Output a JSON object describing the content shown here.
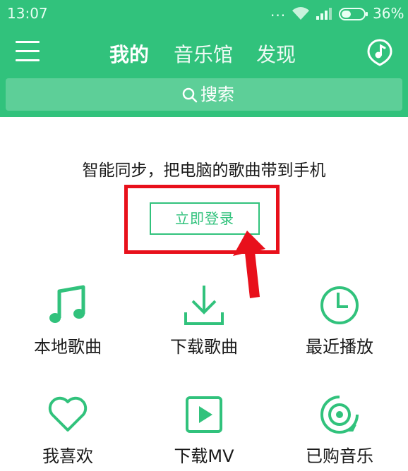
{
  "status_bar": {
    "time": "13:07",
    "dots": "...",
    "battery_pct": "36%"
  },
  "header": {
    "tabs": [
      {
        "label": "我的",
        "active": true
      },
      {
        "label": "音乐馆",
        "active": false
      },
      {
        "label": "发现",
        "active": false
      }
    ],
    "search_label": "搜索",
    "accent_color": "#31c27c"
  },
  "main": {
    "sync_text": "智能同步，把电脑的歌曲带到手机",
    "login_label": "立即登录"
  },
  "annotation": {
    "color": "#e8101b"
  },
  "grid": [
    {
      "label": "本地歌曲",
      "icon": "music-note-icon"
    },
    {
      "label": "下载歌曲",
      "icon": "download-icon"
    },
    {
      "label": "最近播放",
      "icon": "clock-icon"
    },
    {
      "label": "我喜欢",
      "icon": "heart-icon"
    },
    {
      "label": "下载MV",
      "icon": "video-play-icon"
    },
    {
      "label": "已购音乐",
      "icon": "purchased-disc-icon"
    }
  ]
}
